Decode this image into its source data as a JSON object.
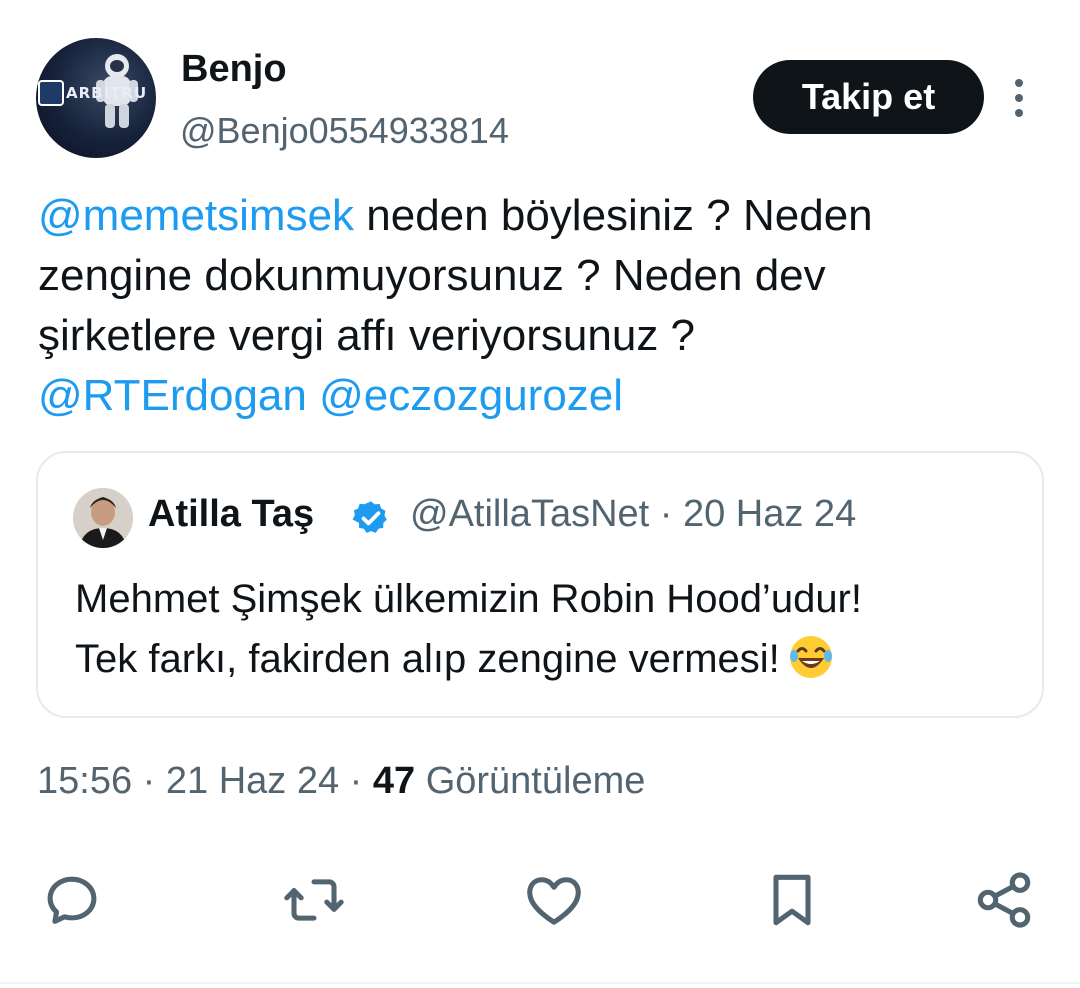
{
  "author": {
    "name": "Benjo",
    "handle": "@Benjo0554933814",
    "avatar_text": "ARBITRU"
  },
  "follow_button": {
    "label": "Takip et"
  },
  "more_icon": "more-vertical-icon",
  "tweet": {
    "mention1": "@memetsimsek",
    "text_line1": " neden böylesiniz ? Neden",
    "text_line2": "zengine dokunmuyorsunuz ? Neden dev",
    "text_line3": "şirketlere vergi affı veriyorsunuz ?",
    "mention2": "@RTErdogan",
    "mention3": "@eczozgurozel"
  },
  "quoted_tweet": {
    "name": "Atilla Taş",
    "meta": "@AtillaTasNet · 20 Haz 24",
    "text_line1": "Mehmet Şimşek ülkemizin Robin Hood’udur!",
    "text_line2": "Tek farkı, fakirden alıp zengine vermesi!",
    "verified_icon": "verified-badge-icon",
    "emoji": "laughing-tears-emoji"
  },
  "meta": {
    "time": "15:56 · 21 Haz 24 · ",
    "views_count": "47",
    "views_label": " Görüntüleme"
  },
  "actions": [
    "reply-icon",
    "retweet-icon",
    "like-icon",
    "bookmark-icon",
    "share-icon"
  ],
  "colors": {
    "link": "#1d9bf0",
    "text": "#0f1419",
    "muted": "#536471",
    "button_bg": "#0f1419",
    "verified": "#1d9bf0"
  }
}
